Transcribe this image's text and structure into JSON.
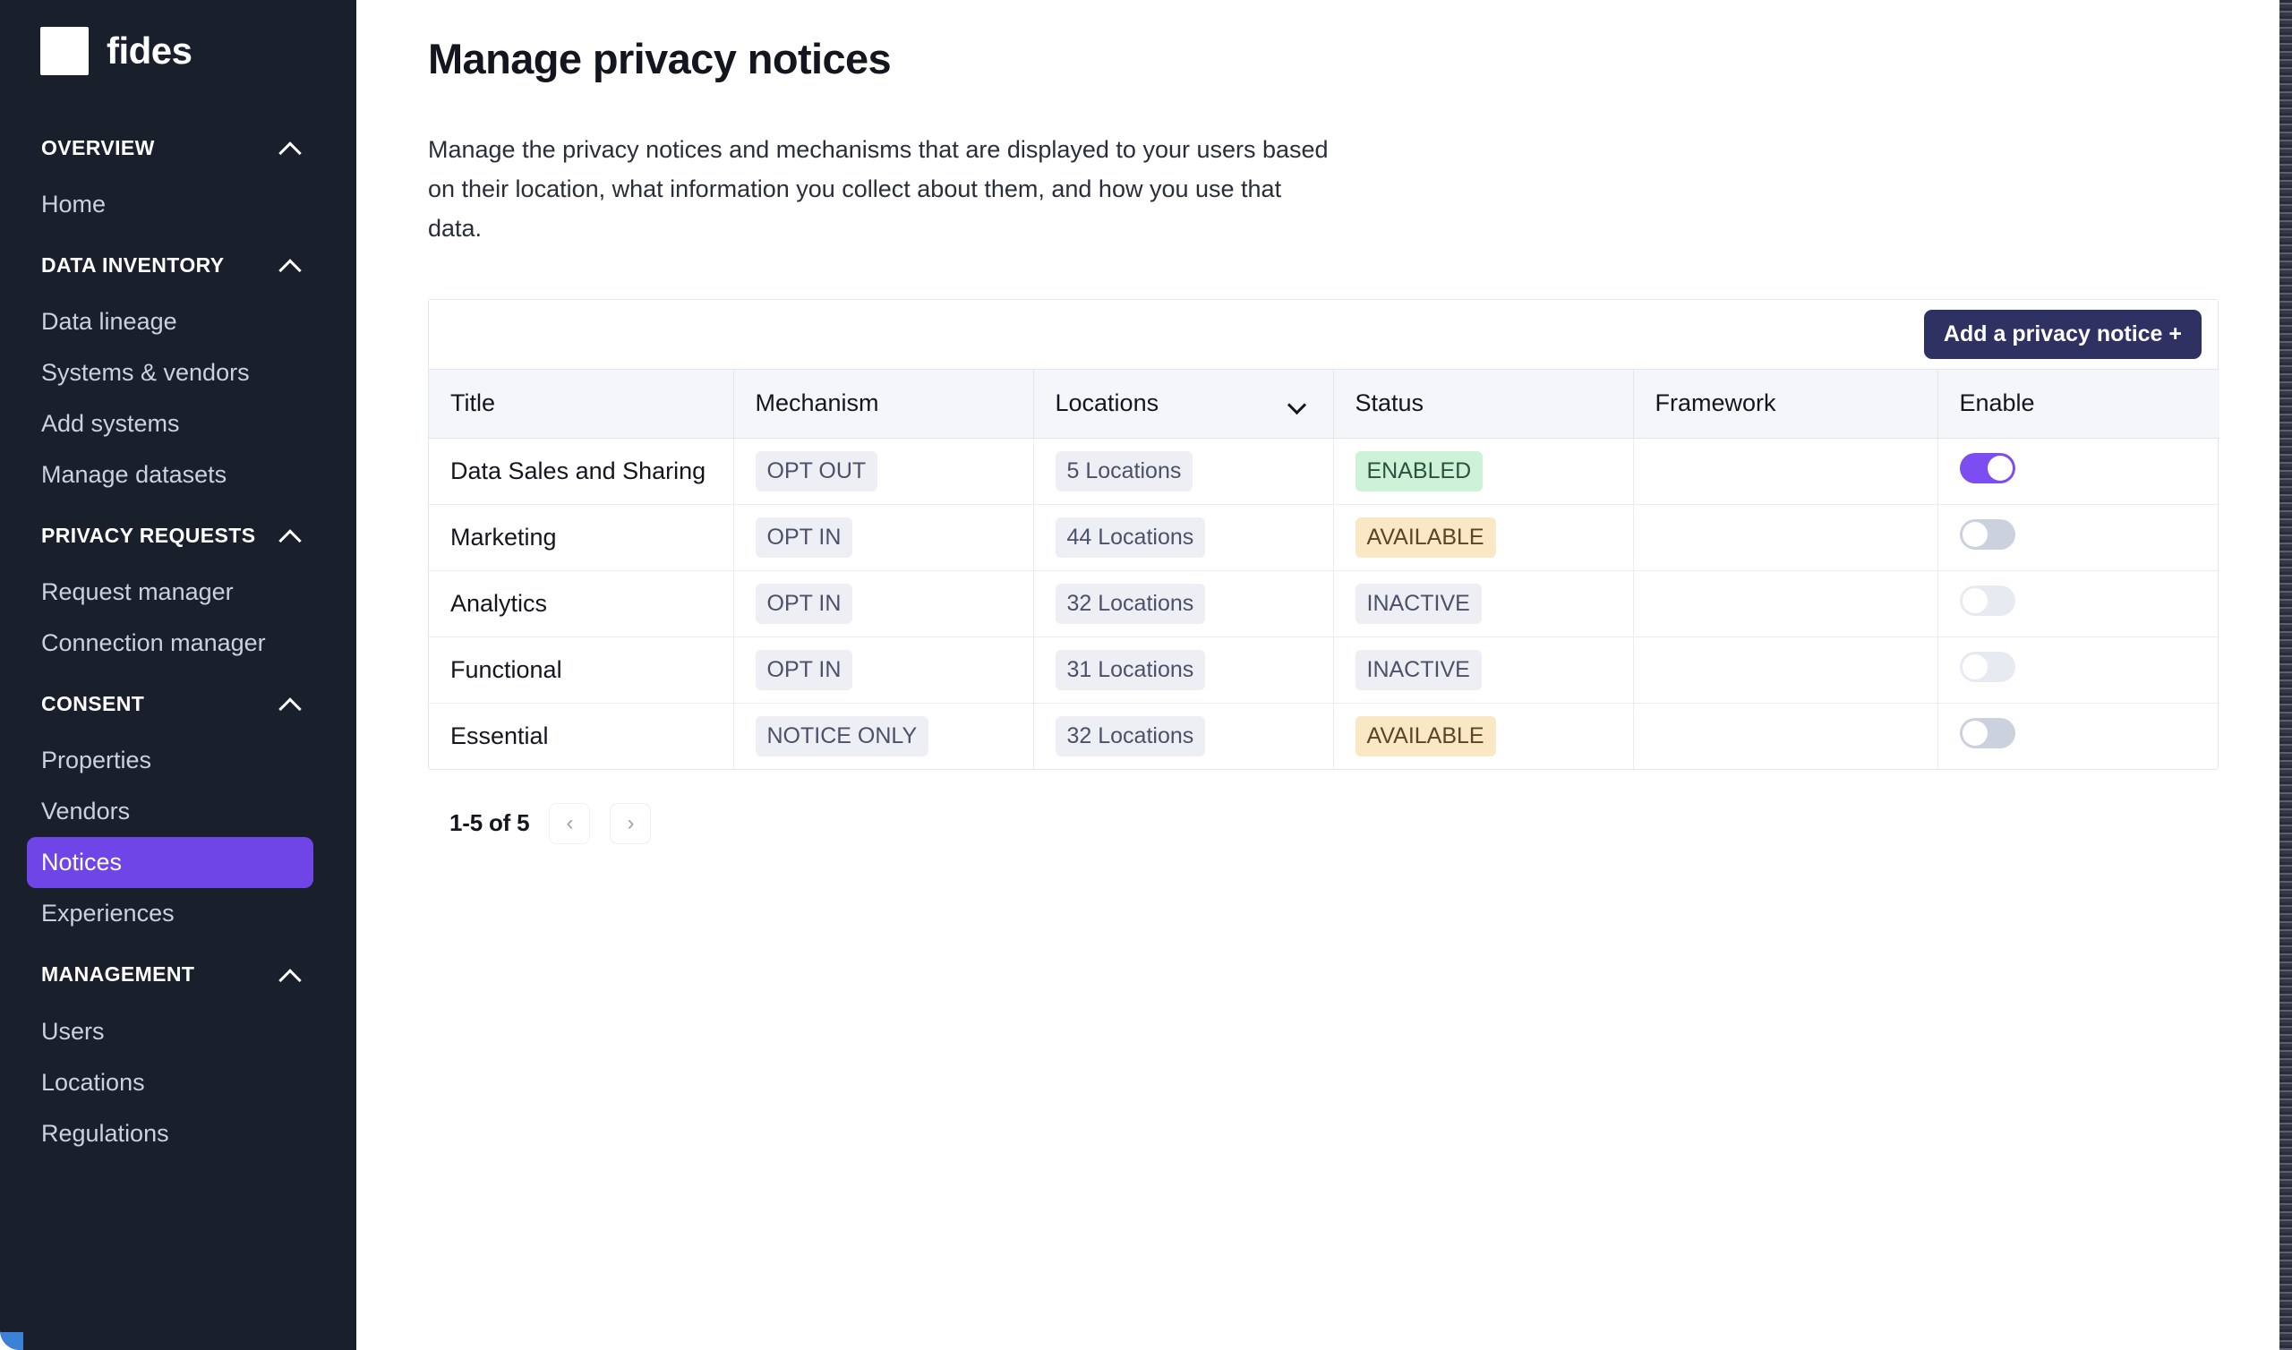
{
  "brand": {
    "name": "fides",
    "logo_icon": "square-logo-icon"
  },
  "sidebar": {
    "sections": [
      {
        "label": "OVERVIEW",
        "collapse_icon": "chevron-up-icon",
        "items": [
          {
            "label": "Home",
            "active": false
          }
        ]
      },
      {
        "label": "DATA INVENTORY",
        "collapse_icon": "chevron-up-icon",
        "items": [
          {
            "label": "Data lineage",
            "active": false
          },
          {
            "label": "Systems & vendors",
            "active": false
          },
          {
            "label": "Add systems",
            "active": false
          },
          {
            "label": "Manage datasets",
            "active": false
          }
        ]
      },
      {
        "label": "PRIVACY REQUESTS",
        "collapse_icon": "chevron-up-icon",
        "items": [
          {
            "label": "Request manager",
            "active": false
          },
          {
            "label": "Connection manager",
            "active": false
          }
        ]
      },
      {
        "label": "CONSENT",
        "collapse_icon": "chevron-up-icon",
        "items": [
          {
            "label": "Properties",
            "active": false
          },
          {
            "label": "Vendors",
            "active": false
          },
          {
            "label": "Notices",
            "active": true
          },
          {
            "label": "Experiences",
            "active": false
          }
        ]
      },
      {
        "label": "MANAGEMENT",
        "collapse_icon": "chevron-up-icon",
        "items": [
          {
            "label": "Users",
            "active": false
          },
          {
            "label": "Locations",
            "active": false
          },
          {
            "label": "Regulations",
            "active": false
          }
        ]
      }
    ]
  },
  "page": {
    "title": "Manage privacy notices",
    "description": "Manage the privacy notices and mechanisms that are displayed to your users based on their location, what information you collect about them, and how you use that data."
  },
  "toolbar": {
    "add_notice_label": "Add a privacy notice +"
  },
  "table": {
    "columns": [
      {
        "label": "Title",
        "sort_icon": null
      },
      {
        "label": "Mechanism",
        "sort_icon": null
      },
      {
        "label": "Locations",
        "sort_icon": "chevron-down-icon"
      },
      {
        "label": "Status",
        "sort_icon": null
      },
      {
        "label": "Framework",
        "sort_icon": null
      },
      {
        "label": "Enable",
        "sort_icon": null
      }
    ],
    "rows": [
      {
        "title": "Data Sales and Sharing",
        "mechanism": "OPT OUT",
        "locations": "5 Locations",
        "status": "ENABLED",
        "status_tone": "green",
        "framework": "",
        "enabled": true,
        "toggle_muted": false
      },
      {
        "title": "Marketing",
        "mechanism": "OPT IN",
        "locations": "44 Locations",
        "status": "AVAILABLE",
        "status_tone": "orange",
        "framework": "",
        "enabled": false,
        "toggle_muted": false
      },
      {
        "title": "Analytics",
        "mechanism": "OPT IN",
        "locations": "32 Locations",
        "status": "INACTIVE",
        "status_tone": "grey",
        "framework": "",
        "enabled": false,
        "toggle_muted": true
      },
      {
        "title": "Functional",
        "mechanism": "OPT IN",
        "locations": "31 Locations",
        "status": "INACTIVE",
        "status_tone": "grey",
        "framework": "",
        "enabled": false,
        "toggle_muted": true
      },
      {
        "title": "Essential",
        "mechanism": "NOTICE ONLY",
        "locations": "32 Locations",
        "status": "AVAILABLE",
        "status_tone": "orange",
        "framework": "",
        "enabled": false,
        "toggle_muted": false
      }
    ]
  },
  "pagination": {
    "range_label": "1-5 of 5",
    "prev_icon": "chevron-left-icon",
    "prev_glyph": "‹",
    "next_icon": "chevron-right-icon",
    "next_glyph": "›"
  },
  "colors": {
    "sidebar_bg": "#1A1F2C",
    "accent_purple": "#6F45E8",
    "toggle_on": "#7C4DF0",
    "primary_button": "#2E3161",
    "status_enabled_bg": "#CDF2D8",
    "status_available_bg": "#FAE7C4",
    "status_inactive_bg": "#EDEFF5",
    "badge_bg": "#EDEFF5"
  }
}
